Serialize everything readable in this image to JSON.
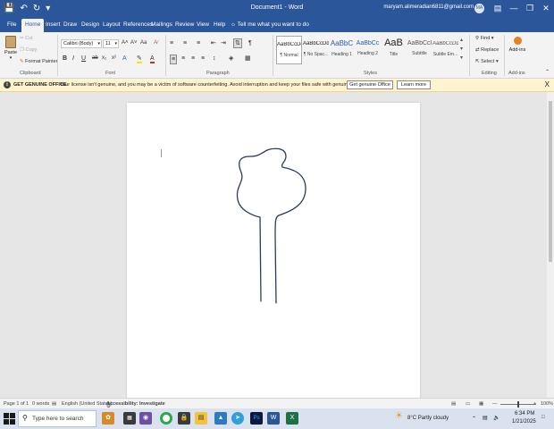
{
  "titlebar": {
    "title": "Document1 - Word",
    "user_email": "maryam.alimeradian6811@gmail.com",
    "avatar_initials": "MA",
    "minimize": "—",
    "restore": "❐",
    "close": "✕"
  },
  "tabs": [
    "File",
    "Home",
    "Insert",
    "Draw",
    "Design",
    "Layout",
    "References",
    "Mailings",
    "Review",
    "View",
    "Help"
  ],
  "tell_me": "Tell me what you want to do",
  "clipboard": {
    "paste": "Paste",
    "cut": "Cut",
    "copy": "Copy",
    "format_painter": "Format Painter",
    "label": "Clipboard"
  },
  "font": {
    "name": "Calibri (Body)",
    "size": "11",
    "label": "Font",
    "grow": "A˄",
    "shrink": "A˅",
    "case": "Aa",
    "bold": "B",
    "italic": "I",
    "underline": "U",
    "strike": "ab",
    "subscript": "x₂",
    "superscript": "x²"
  },
  "paragraph": {
    "label": "Paragraph"
  },
  "styles": {
    "label": "Styles",
    "items": [
      {
        "sample": "AaBbCcDd",
        "name": "¶ Normal"
      },
      {
        "sample": "AaBbCcDd",
        "name": "¶ No Spac..."
      },
      {
        "sample": "AaBbC",
        "name": "Heading 1"
      },
      {
        "sample": "AaBbCc",
        "name": "Heading 2"
      },
      {
        "sample": "AaB",
        "name": "Title"
      },
      {
        "sample": "AaBbCcl",
        "name": "Subtitle"
      },
      {
        "sample": "AaBbCcDd",
        "name": "Subtle Em..."
      }
    ]
  },
  "editing": {
    "find": "Find",
    "replace": "Replace",
    "select": "Select",
    "label": "Editing"
  },
  "addins": {
    "button": "Add-ins",
    "label": "Add-ins"
  },
  "message_bar": {
    "heading": "GET GENUINE OFFICE",
    "text": "Your license isn't genuine, and you may be a victim of software counterfeiting. Avoid interruption and keep your files safe with genuine Office today.",
    "button1": "Get genuine Office",
    "button2": "Learn more",
    "close": "X"
  },
  "statusbar": {
    "page": "Page 1 of 1",
    "words": "0 words",
    "language": "English (United States)",
    "accessibility": "Accessibility: Investigate",
    "zoom": "100%"
  },
  "taskbar": {
    "search_placeholder": "Type here to search",
    "weather": "8°C  Partly cloudy",
    "time": "6:34 PM",
    "date": "1/21/2025"
  },
  "colors": {
    "word_blue": "#2b579a",
    "ribbon_bg": "#f3f3f3",
    "message_bar_bg": "#fff4ce",
    "doc_bg": "#e6e6e6",
    "drawing_stroke": "#2b3a5c"
  }
}
